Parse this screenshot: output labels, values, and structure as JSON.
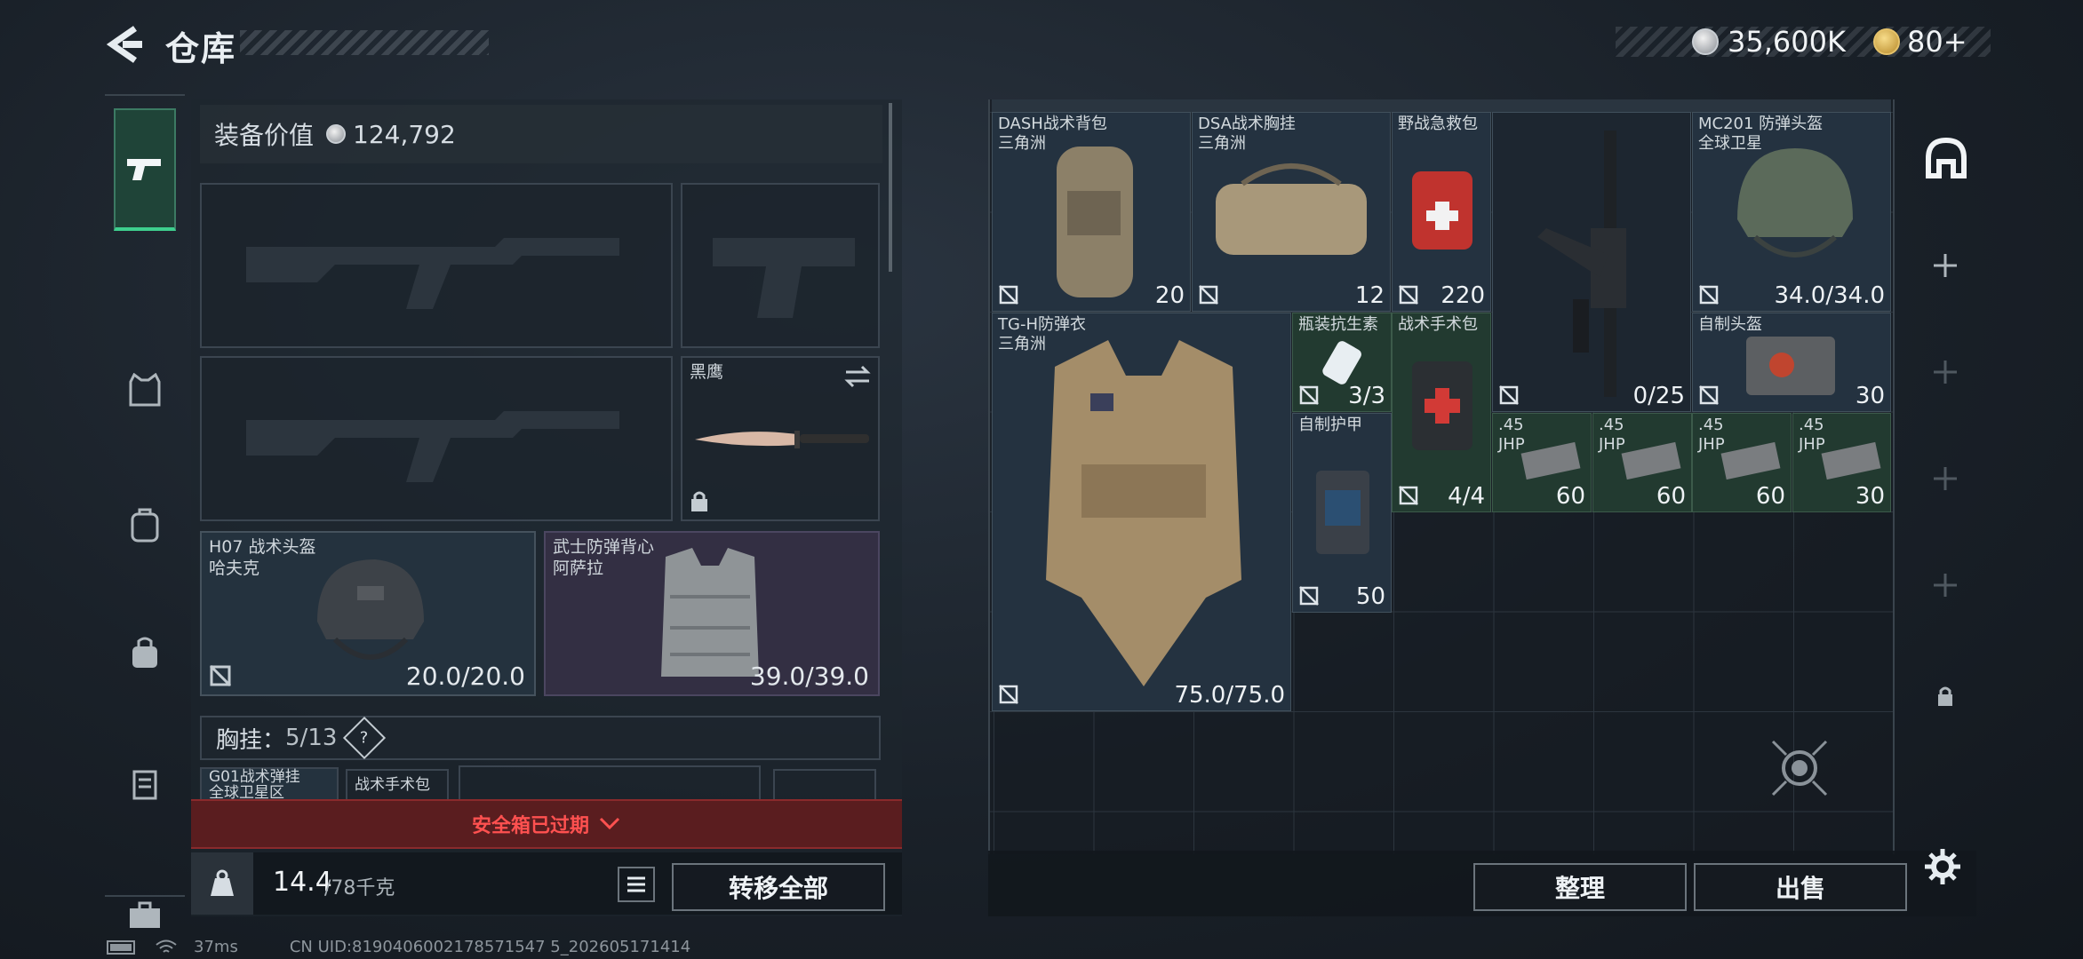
{
  "header": {
    "title": "仓库"
  },
  "currency": {
    "coins": "35,600K",
    "tokens": "80+"
  },
  "left_nav": {
    "items": [
      "pistol-icon",
      "vest-icon",
      "backpack-icon",
      "bag-icon",
      "container-icon",
      "case-icon"
    ]
  },
  "equipment": {
    "value_label": "装备价值",
    "value": "124,792",
    "knife_label": "黑鹰",
    "helmet": {
      "name": "H07 战术头盔",
      "map": "哈夫克",
      "durability": "20.0/20.0"
    },
    "armor": {
      "name": "武士防弹背心",
      "map": "阿萨拉",
      "durability": "39.0/39.0"
    },
    "chest_rig_label": "胸挂：",
    "chest_rig_count": "5/13",
    "chest_rig_help": "?",
    "chest_item1": "G01战术弹挂",
    "chest_item1_sub": "全球卫星区",
    "chest_item2": "战术手术包"
  },
  "safe_box": {
    "warning": "安全箱已过期"
  },
  "weight": {
    "current": "14.4",
    "max": "/78千克"
  },
  "buttons": {
    "transfer_all": "转移全部",
    "sort": "整理",
    "sell": "出售"
  },
  "stash_items": [
    {
      "name": "DASH战术背包",
      "sub": "三角洲",
      "value": "20"
    },
    {
      "name": "DSA战术胸挂",
      "sub": "三角洲",
      "value": "12"
    },
    {
      "name": "野战急救包",
      "sub": "",
      "value": "220"
    },
    {
      "name": "",
      "sub": "",
      "value": "0/25"
    },
    {
      "name": "MC201 防弹头盔",
      "sub": "全球卫星",
      "value": "34.0/34.0"
    },
    {
      "name": "TG-H防弹衣",
      "sub": "三角洲",
      "value": "75.0/75.0"
    },
    {
      "name": "瓶装抗生素",
      "sub": "",
      "value": "3/3"
    },
    {
      "name": "战术手术包",
      "sub": "",
      "value": "4/4"
    },
    {
      "name": "自制头盔",
      "sub": "",
      "value": "30"
    },
    {
      "name": "自制护甲",
      "sub": "",
      "value": "50"
    },
    {
      "name": ".45",
      "sub": "JHP",
      "value": "60"
    },
    {
      "name": ".45",
      "sub": "JHP",
      "value": "60"
    },
    {
      "name": ".45",
      "sub": "JHP",
      "value": "60"
    },
    {
      "name": ".45",
      "sub": "JHP",
      "value": "30"
    }
  ],
  "status_bar": {
    "ping": "37ms",
    "uid": "CN UID:8190406002178571547 5_202605171414"
  }
}
